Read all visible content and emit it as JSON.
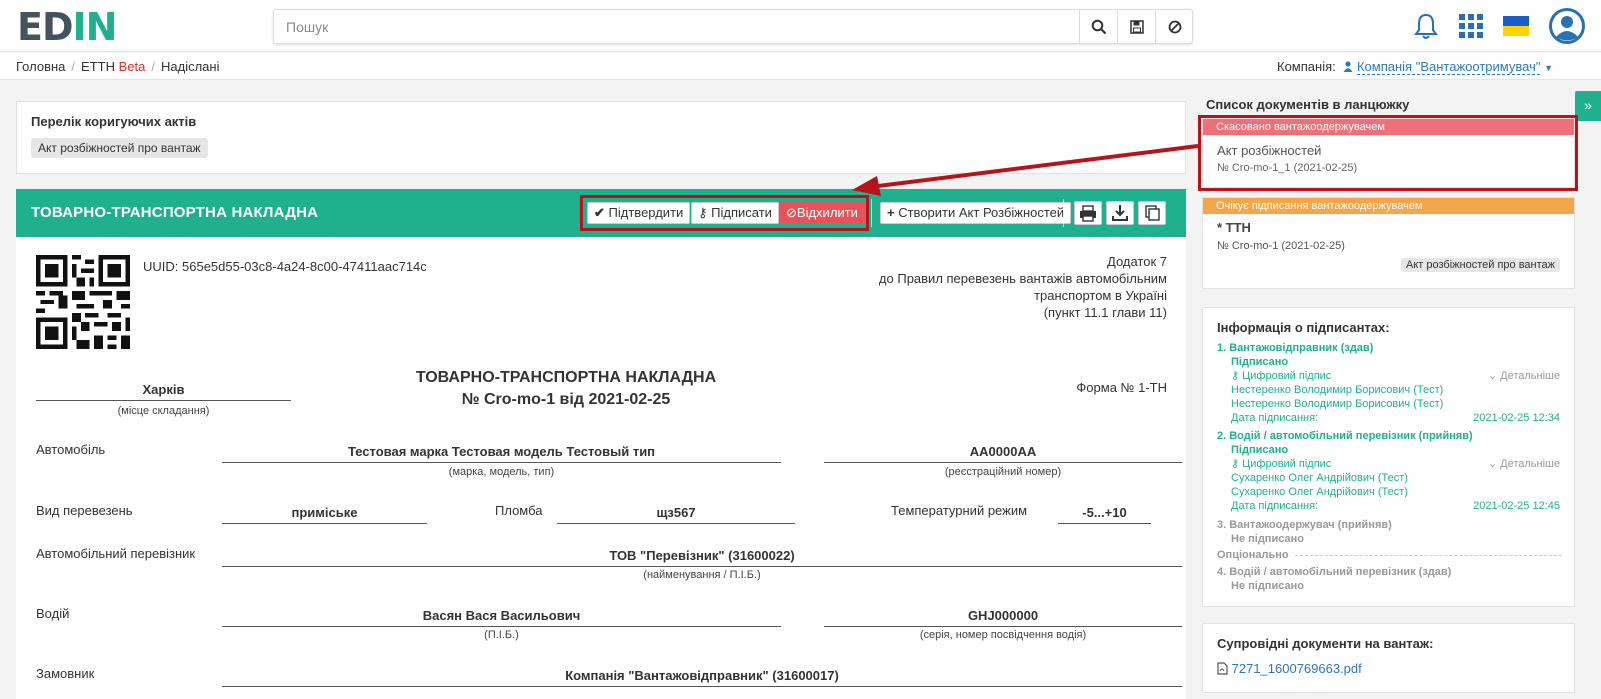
{
  "header": {
    "logo_part1": "ED",
    "logo_part2": "IN",
    "search_placeholder": "Пошук",
    "icons": [
      "search-icon",
      "save-icon",
      "cancel-icon",
      "bell-icon",
      "apps-grid-icon",
      "ukraine-flag-icon",
      "user-avatar-icon"
    ],
    "accent": "#1fb08e"
  },
  "breadcrumb": {
    "home": "Головна",
    "section": "ЕТТН",
    "section_badge": "Beta",
    "current": "Надіслані",
    "company_label": "Компанія:",
    "company_value": "Компанія \"Вантажоотримувач\""
  },
  "acts": {
    "title": "Перелік коригуючих актів",
    "items": [
      "Акт розбіжностей про вантаж"
    ]
  },
  "toolbar": {
    "title": "ТОВАРНО-ТРАНСПОРТНА НАКЛАДНА",
    "confirm": "Підтвердити",
    "sign": "Підписати",
    "reject": "Відхилити",
    "create_act": "Створити Акт Розбіжностей",
    "icons": [
      "print-icon",
      "download-icon",
      "copy-icon"
    ]
  },
  "document": {
    "uuid": "UUID: 565e5d55-03c8-4a24-8c00-47411aac714c",
    "appendix": [
      "Додаток 7",
      "до Правил перевезень вантажів автомобільним",
      "транспортом в Україні",
      "(пункт 11.1 глави 11)"
    ],
    "title_line1": "ТОВАРНО-ТРАНСПОРТНА НАКЛАДНА",
    "title_line2": "№ Cro-mo-1 від 2021-02-25",
    "place": "Харків",
    "place_caption": "(місце складання)",
    "form_number": "Форма № 1-ТН",
    "car_label": "Автомобіль",
    "car_value": "Тестовая марка Тестовая модель Тестовый тип",
    "car_caption": "(марка, модель, тип)",
    "plate_value": "AA0000AA",
    "plate_caption": "(реєстраційний номер)",
    "transport_type_label": "Вид перевезень",
    "transport_type_value": "приміське",
    "seal_label": "Пломба",
    "seal_value": "щз567",
    "temp_label": "Температурний режим",
    "temp_value": "-5...+10",
    "carrier_label": "Автомобільний перевізник",
    "carrier_value": "ТОВ \"Перевізник\" (31600022)",
    "carrier_caption": "(найменування / П.І.Б.)",
    "driver_label": "Водій",
    "driver_value": "Васян Вася Васильович",
    "driver_caption": "(П.І.Б.)",
    "license_value": "GHJ000000",
    "license_caption": "(серія, номер посвідчення водія)",
    "customer_label": "Замовник",
    "customer_value": "Компанія \"Вантажовідправник\" (31600017)"
  },
  "chain": {
    "title": "Список документів в ланцюжку",
    "doc1": {
      "status": "Скасовано вантажоодержувачем",
      "status_color": "#f0707a",
      "name": "Акт розбіжностей",
      "number": "№ Cro-mo-1_1 (2021-02-25)"
    },
    "doc2": {
      "status": "Очікує підписання вантажоодержувачем",
      "status_color": "#f5a54a",
      "name": "* ТТН",
      "number": "№ Cro-mo-1 (2021-02-25)",
      "tag": "Акт розбіжностей про вантаж"
    }
  },
  "signers": {
    "title": "Інформація о підписантах:",
    "s1": {
      "role": "1.  Вантажовідправник (здав)",
      "status": "Підписано",
      "sig": "Цифровий підпис",
      "details": "Детальніше",
      "name1": "Нестеренко Володимир Борисович (Тест)",
      "name2": "Нестеренко Володимир Борисович (Тест)",
      "date_label": "Дата підписання:",
      "date": "2021-02-25 12:34"
    },
    "s2": {
      "role": "2.  Водій / автомобільний перевізник (прийняв)",
      "status": "Підписано",
      "sig": "Цифровий підпис",
      "details": "Детальніше",
      "name1": "Сухаренко Олег Андрійович (Тест)",
      "name2": "Сухаренко Олег Андрійович (Тест)",
      "date_label": "Дата підписання:",
      "date": "2021-02-25 12:45"
    },
    "s3": {
      "role": "3.  Вантажоодержувач (прийняв)",
      "status": "Не підписано"
    },
    "optional": "Опціонально",
    "s4": {
      "role": "4.  Водій / автомобільний перевізник (здав)",
      "status": "Не підписано"
    }
  },
  "support": {
    "title": "Супровідні документи на вантаж:",
    "file": "7271_1600769663.pdf"
  }
}
